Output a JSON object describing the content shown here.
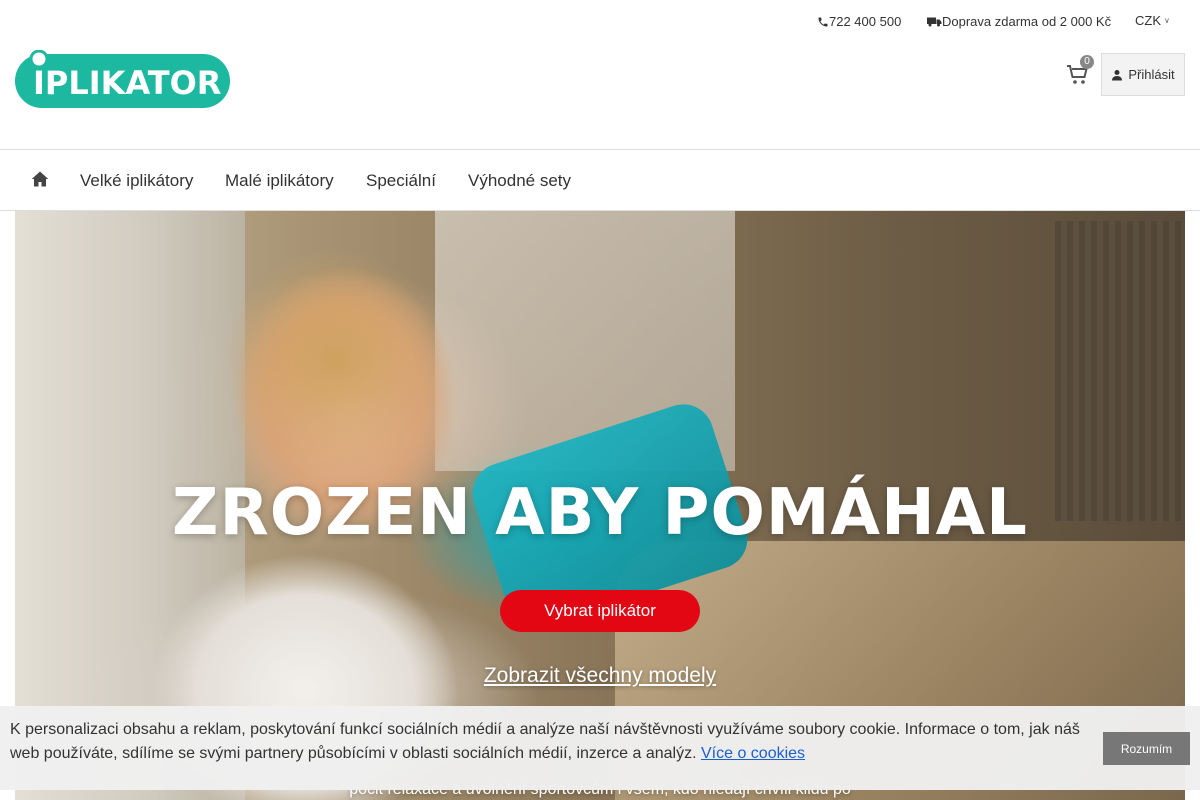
{
  "topbar": {
    "phone": "722 400 500",
    "phone_icon": "phone-icon",
    "shipping": "Doprava zdarma od 2 000 Kč",
    "shipping_icon": "truck-icon",
    "currency": "CZK"
  },
  "brand": {
    "logo_text": "IPLIKATOR",
    "logo_color": "#1cb8a0"
  },
  "header": {
    "cart_count": "0",
    "cart_icon": "cart-icon",
    "login_label": "Přihlásit",
    "login_icon": "user-icon"
  },
  "nav": {
    "home_icon": "home-icon",
    "items": [
      {
        "label": "Velké iplikátory"
      },
      {
        "label": "Malé iplikátory"
      },
      {
        "label": "Speciální"
      },
      {
        "label": "Výhodné sety"
      }
    ]
  },
  "hero": {
    "title": "ZROZEN ABY POMÁHAL",
    "cta_label": "Vybrat iplikátor",
    "cta_color": "#e30613",
    "link_label": "Zobrazit všechny modely",
    "subtext": "pocit relaxace a uvolnění sportovcům i všem, kdo hledají chvíli klidu po"
  },
  "cookie": {
    "text": "K personalizaci obsahu a reklam, poskytování funkcí sociálních médií a analýze naší návštěvnosti využíváme soubory cookie. Informace o tom, jak náš web používáte, sdílíme se svými partnery působícími v oblasti sociálních médií, inzerce a analýz.",
    "link_label": "Více o cookies",
    "accept_label": "Rozumím"
  }
}
